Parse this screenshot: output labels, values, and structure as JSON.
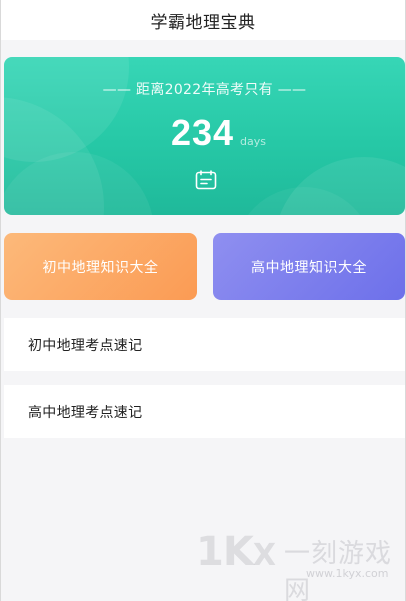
{
  "header": {
    "title": "学霸地理宝典"
  },
  "countdown": {
    "subtitle": "—— 距离2022年高考只有 ——",
    "days_value": "234",
    "days_unit": "days",
    "icon": "calendar-icon",
    "colors": {
      "from": "#37d6b6",
      "to": "#1fb99a"
    }
  },
  "cards": [
    {
      "label": "初中地理知识大全",
      "color": "#fb9b54"
    },
    {
      "label": "高中地理知识大全",
      "color": "#6d70ea"
    }
  ],
  "list": [
    {
      "label": "初中地理考点速记"
    },
    {
      "label": "高中地理考点速记"
    }
  ],
  "watermark": {
    "logo_text": "1K",
    "logo_mark": "X",
    "name": "一刻游戏网",
    "url": "www.1kyx.com"
  }
}
